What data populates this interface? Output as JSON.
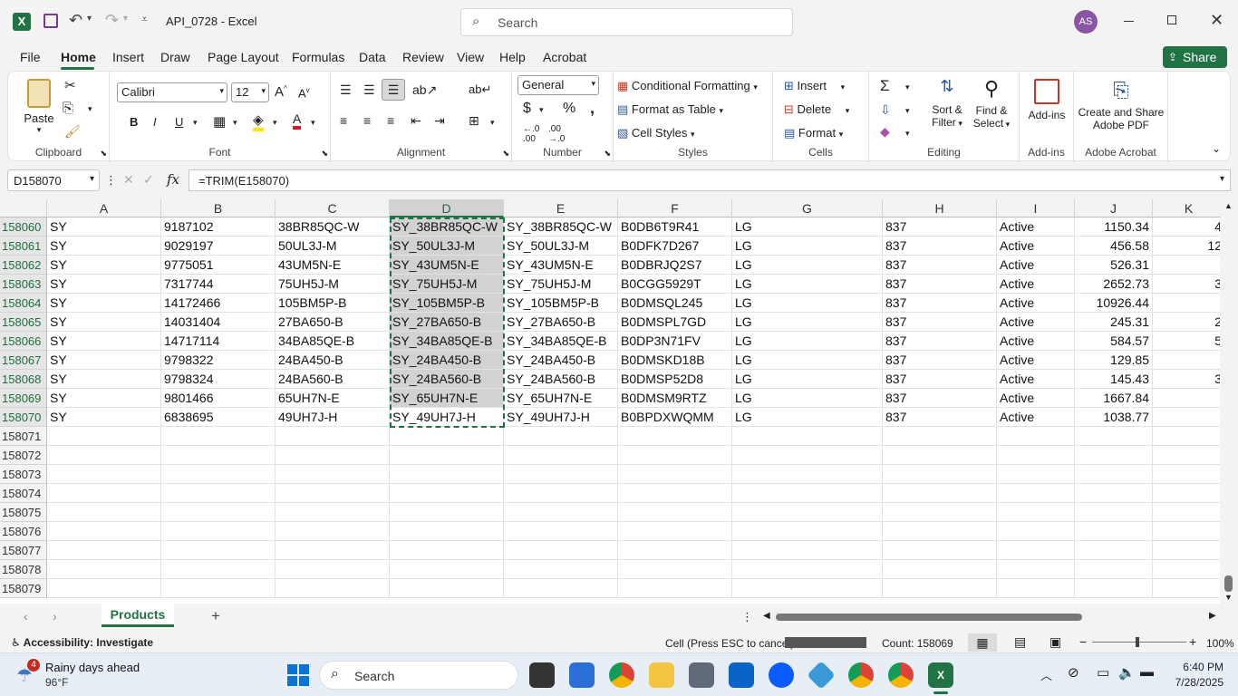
{
  "app": {
    "filename": "API_0728",
    "sep": " - ",
    "appname": "Excel",
    "search_placeholder": "Search",
    "user_initials": "AS"
  },
  "menu": [
    "File",
    "Home",
    "Insert",
    "Draw",
    "Page Layout",
    "Formulas",
    "Data",
    "Review",
    "View",
    "Help",
    "Acrobat"
  ],
  "share_label": "Share",
  "ribbon": {
    "clipboard": {
      "paste": "Paste",
      "label": "Clipboard"
    },
    "font": {
      "name": "Calibri",
      "size": "12",
      "label": "Font"
    },
    "alignment": {
      "label": "Alignment"
    },
    "number": {
      "format": "General",
      "label": "Number"
    },
    "styles": {
      "cond": "Conditional Formatting",
      "table": "Format as Table",
      "cell": "Cell Styles",
      "label": "Styles"
    },
    "cells": {
      "insert": "Insert",
      "delete": "Delete",
      "format": "Format",
      "label": "Cells"
    },
    "editing": {
      "sort1": "Sort &",
      "sort2": "Filter",
      "find1": "Find &",
      "find2": "Select",
      "label": "Editing"
    },
    "addins": {
      "btn": "Add-ins",
      "label": "Add-ins"
    },
    "acrobat": {
      "btn1": "Create and Share",
      "btn2": "Adobe PDF",
      "label": "Adobe Acrobat"
    }
  },
  "namebox": "D158070",
  "fx": "fx",
  "formula": "=TRIM(E158070)",
  "columns": [
    "A",
    "B",
    "C",
    "D",
    "E",
    "F",
    "G",
    "H",
    "I",
    "J",
    "K"
  ],
  "rows": [
    {
      "n": "158060",
      "a": "SY",
      "b": "9187102",
      "c": "38BR85QC-W",
      "d": "SY_38BR85QC-W",
      "e": "SY_38BR85QC-W",
      "f": "B0DB6T9R41",
      "g": "LG",
      "h": "837",
      "i": "Active",
      "j": "1150.34",
      "k": "4"
    },
    {
      "n": "158061",
      "a": "SY",
      "b": "9029197",
      "c": "50UL3J-M",
      "d": "SY_50UL3J-M",
      "e": "SY_50UL3J-M",
      "f": "B0DFK7D267",
      "g": "LG",
      "h": "837",
      "i": "Active",
      "j": "456.58",
      "k": "12"
    },
    {
      "n": "158062",
      "a": "SY",
      "b": "9775051",
      "c": "43UM5N-E",
      "d": "SY_43UM5N-E",
      "e": "SY_43UM5N-E",
      "f": "B0DBRJQ2S7",
      "g": "LG",
      "h": "837",
      "i": "Active",
      "j": "526.31",
      "k": ""
    },
    {
      "n": "158063",
      "a": "SY",
      "b": "7317744",
      "c": "75UH5J-M",
      "d": "SY_75UH5J-M",
      "e": "SY_75UH5J-M",
      "f": "B0CGG5929T",
      "g": "LG",
      "h": "837",
      "i": "Active",
      "j": "2652.73",
      "k": "3"
    },
    {
      "n": "158064",
      "a": "SY",
      "b": "14172466",
      "c": "105BM5P-B",
      "d": "SY_105BM5P-B",
      "e": "SY_105BM5P-B",
      "f": "B0DMSQL245",
      "g": "LG",
      "h": "837",
      "i": "Active",
      "j": "10926.44",
      "k": ""
    },
    {
      "n": "158065",
      "a": "SY",
      "b": "14031404",
      "c": "27BA650-B",
      "d": "SY_27BA650-B",
      "e": "SY_27BA650-B",
      "f": "B0DMSPL7GD",
      "g": "LG",
      "h": "837",
      "i": "Active",
      "j": "245.31",
      "k": "2"
    },
    {
      "n": "158066",
      "a": "SY",
      "b": "14717114",
      "c": "34BA85QE-B",
      "d": "SY_34BA85QE-B",
      "e": "SY_34BA85QE-B",
      "f": "B0DP3N71FV",
      "g": "LG",
      "h": "837",
      "i": "Active",
      "j": "584.57",
      "k": "5"
    },
    {
      "n": "158067",
      "a": "SY",
      "b": "9798322",
      "c": "24BA450-B",
      "d": "SY_24BA450-B",
      "e": "SY_24BA450-B",
      "f": "B0DMSKD18B",
      "g": "LG",
      "h": "837",
      "i": "Active",
      "j": "129.85",
      "k": ""
    },
    {
      "n": "158068",
      "a": "SY",
      "b": "9798324",
      "c": "24BA560-B",
      "d": "SY_24BA560-B",
      "e": "SY_24BA560-B",
      "f": "B0DMSP52D8",
      "g": "LG",
      "h": "837",
      "i": "Active",
      "j": "145.43",
      "k": "3"
    },
    {
      "n": "158069",
      "a": "SY",
      "b": "9801466",
      "c": "65UH7N-E",
      "d": "SY_65UH7N-E",
      "e": "SY_65UH7N-E",
      "f": "B0DMSM9RTZ",
      "g": "LG",
      "h": "837",
      "i": "Active",
      "j": "1667.84",
      "k": ""
    },
    {
      "n": "158070",
      "a": "SY",
      "b": "6838695",
      "c": "49UH7J-H",
      "d": "SY_49UH7J-H",
      "e": "SY_49UH7J-H",
      "f": "B0BPDXWQMM",
      "g": "LG",
      "h": "837",
      "i": "Active",
      "j": "1038.77",
      "k": ""
    }
  ],
  "empty_rows": [
    "158071",
    "158072",
    "158073",
    "158074",
    "158075",
    "158076",
    "158077",
    "158078",
    "158079"
  ],
  "sheet_tab": "Products",
  "status": {
    "accessibility": "Accessibility: Investigate",
    "mode": "Cell (Press ESC to cancel):",
    "count": "Count: 158069",
    "zoom": "100%"
  },
  "taskbar": {
    "weather_badge": "4",
    "weather_title": "Rainy days ahead",
    "weather_temp": "96°F",
    "search": "Search",
    "time": "6:40 PM",
    "date": "7/28/2025"
  },
  "colors": {
    "excel_green": "#217346",
    "selection_gray": "#d2d2d2",
    "accent_purple": "#8a55a3"
  }
}
